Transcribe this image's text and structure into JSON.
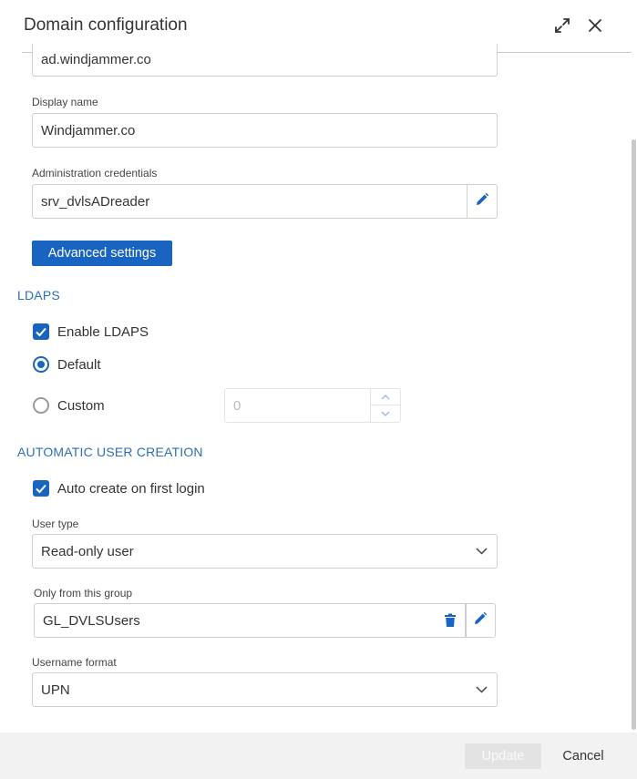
{
  "dialog": {
    "title": "Domain configuration",
    "expand_icon": "expand-icon",
    "close_icon": "close-icon"
  },
  "fields": {
    "domain_value": "ad.windjammer.co",
    "display_name_label": "Display name",
    "display_name_value": "Windjammer.co",
    "admin_credentials_label": "Administration credentials",
    "admin_credentials_value": "srv_dvlsADreader"
  },
  "advanced_settings_label": "Advanced settings",
  "ldaps": {
    "section_title": "LDAPS",
    "enable_label": "Enable LDAPS",
    "enable_checked": true,
    "default_label": "Default",
    "custom_label": "Custom",
    "selected": "Default",
    "custom_port_placeholder": "0"
  },
  "auto_user": {
    "section_title": "AUTOMATIC USER CREATION",
    "auto_create_label": "Auto create on first login",
    "auto_create_checked": true,
    "user_type_label": "User type",
    "user_type_value": "Read-only user",
    "group_label": "Only from this group",
    "group_value": "GL_DVLSUsers",
    "username_format_label": "Username format",
    "username_format_value": "UPN"
  },
  "footer": {
    "update_label": "Update",
    "cancel_label": "Cancel"
  },
  "colors": {
    "accent": "#1864c0",
    "section": "#2e6db8"
  }
}
